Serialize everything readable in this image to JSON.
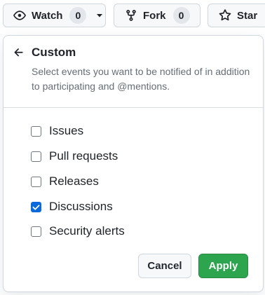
{
  "topbar": {
    "watch": {
      "label": "Watch",
      "count": "0"
    },
    "fork": {
      "label": "Fork",
      "count": "0"
    },
    "star": {
      "label": "Star"
    }
  },
  "dropdown": {
    "title": "Custom",
    "description": "Select events you want to be notified of in addition to participating and @mentions.",
    "options": [
      {
        "label": "Issues",
        "checked": false
      },
      {
        "label": "Pull requests",
        "checked": false
      },
      {
        "label": "Releases",
        "checked": false
      },
      {
        "label": "Discussions",
        "checked": true
      },
      {
        "label": "Security alerts",
        "checked": false
      }
    ],
    "cancel_label": "Cancel",
    "apply_label": "Apply"
  },
  "colors": {
    "accent_blue": "#0969da",
    "apply_green": "#2da44e",
    "border": "#d0d7de"
  }
}
